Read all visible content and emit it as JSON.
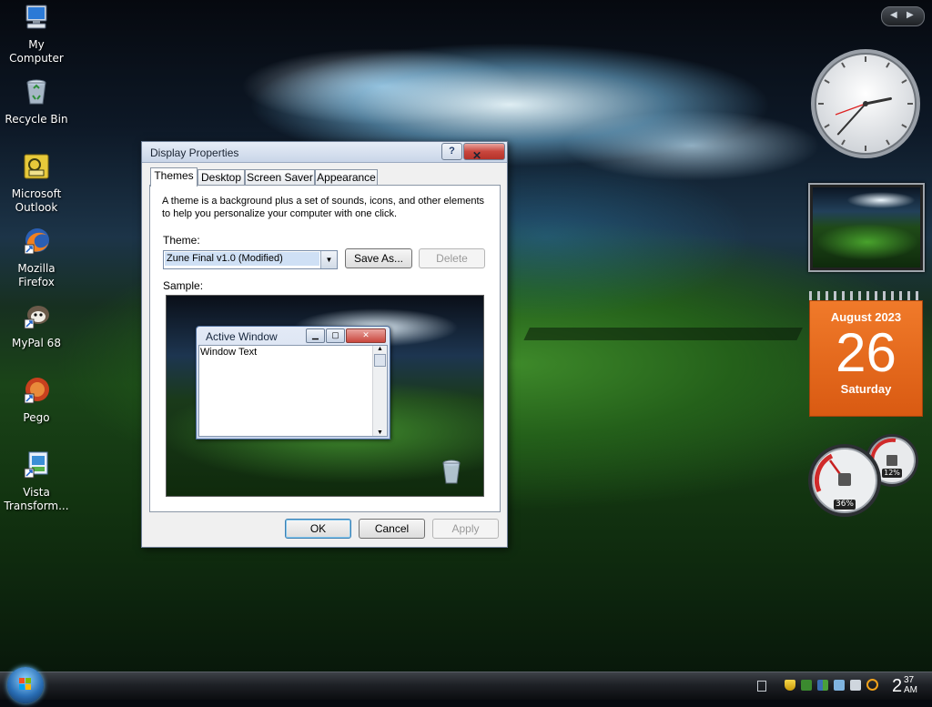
{
  "desktop_icons": [
    {
      "label": "My Computer",
      "icon": "computer-icon"
    },
    {
      "label": "Recycle Bin",
      "icon": "recycle-bin-icon"
    },
    {
      "label": "Microsoft Outlook",
      "icon": "outlook-icon"
    },
    {
      "label": "Mozilla Firefox",
      "icon": "firefox-icon"
    },
    {
      "label": "MyPal 68",
      "icon": "mypal-icon"
    },
    {
      "label": "Pego",
      "icon": "pego-icon"
    },
    {
      "label": "Vista Transform...",
      "icon": "vista-transform-icon"
    }
  ],
  "dialog": {
    "title": "Display Properties",
    "help_label": "?",
    "close_label": "✕",
    "tabs": [
      {
        "label": "Themes",
        "active": true
      },
      {
        "label": "Desktop",
        "active": false
      },
      {
        "label": "Screen Saver",
        "active": false
      },
      {
        "label": "Appearance",
        "active": false
      }
    ],
    "description": "A theme is a background plus a set of sounds, icons, and other elements to help you personalize your computer with one click.",
    "theme_label": "Theme:",
    "theme_value": "Zune Final v1.0 (Modified)",
    "save_as_label": "Save As...",
    "delete_label": "Delete",
    "sample_label": "Sample:",
    "sample": {
      "window_title": "Active Window",
      "window_text": "Window Text"
    },
    "ok_label": "OK",
    "cancel_label": "Cancel",
    "apply_label": "Apply"
  },
  "gadgets": {
    "calendar": {
      "month_year": "August 2023",
      "day": "26",
      "weekday": "Saturday"
    },
    "cpu_meter": {
      "cpu": "36%",
      "memory": "12%"
    },
    "clock": {
      "hour": 2,
      "minute": 37
    }
  },
  "taskbar": {
    "clock_hour": "2",
    "clock_minute": "37",
    "clock_ampm": "AM"
  },
  "colors": {
    "calendar_orange": "#e8661c",
    "dialog_bg": "#f0f0f0",
    "close_red": "#c9463d"
  }
}
